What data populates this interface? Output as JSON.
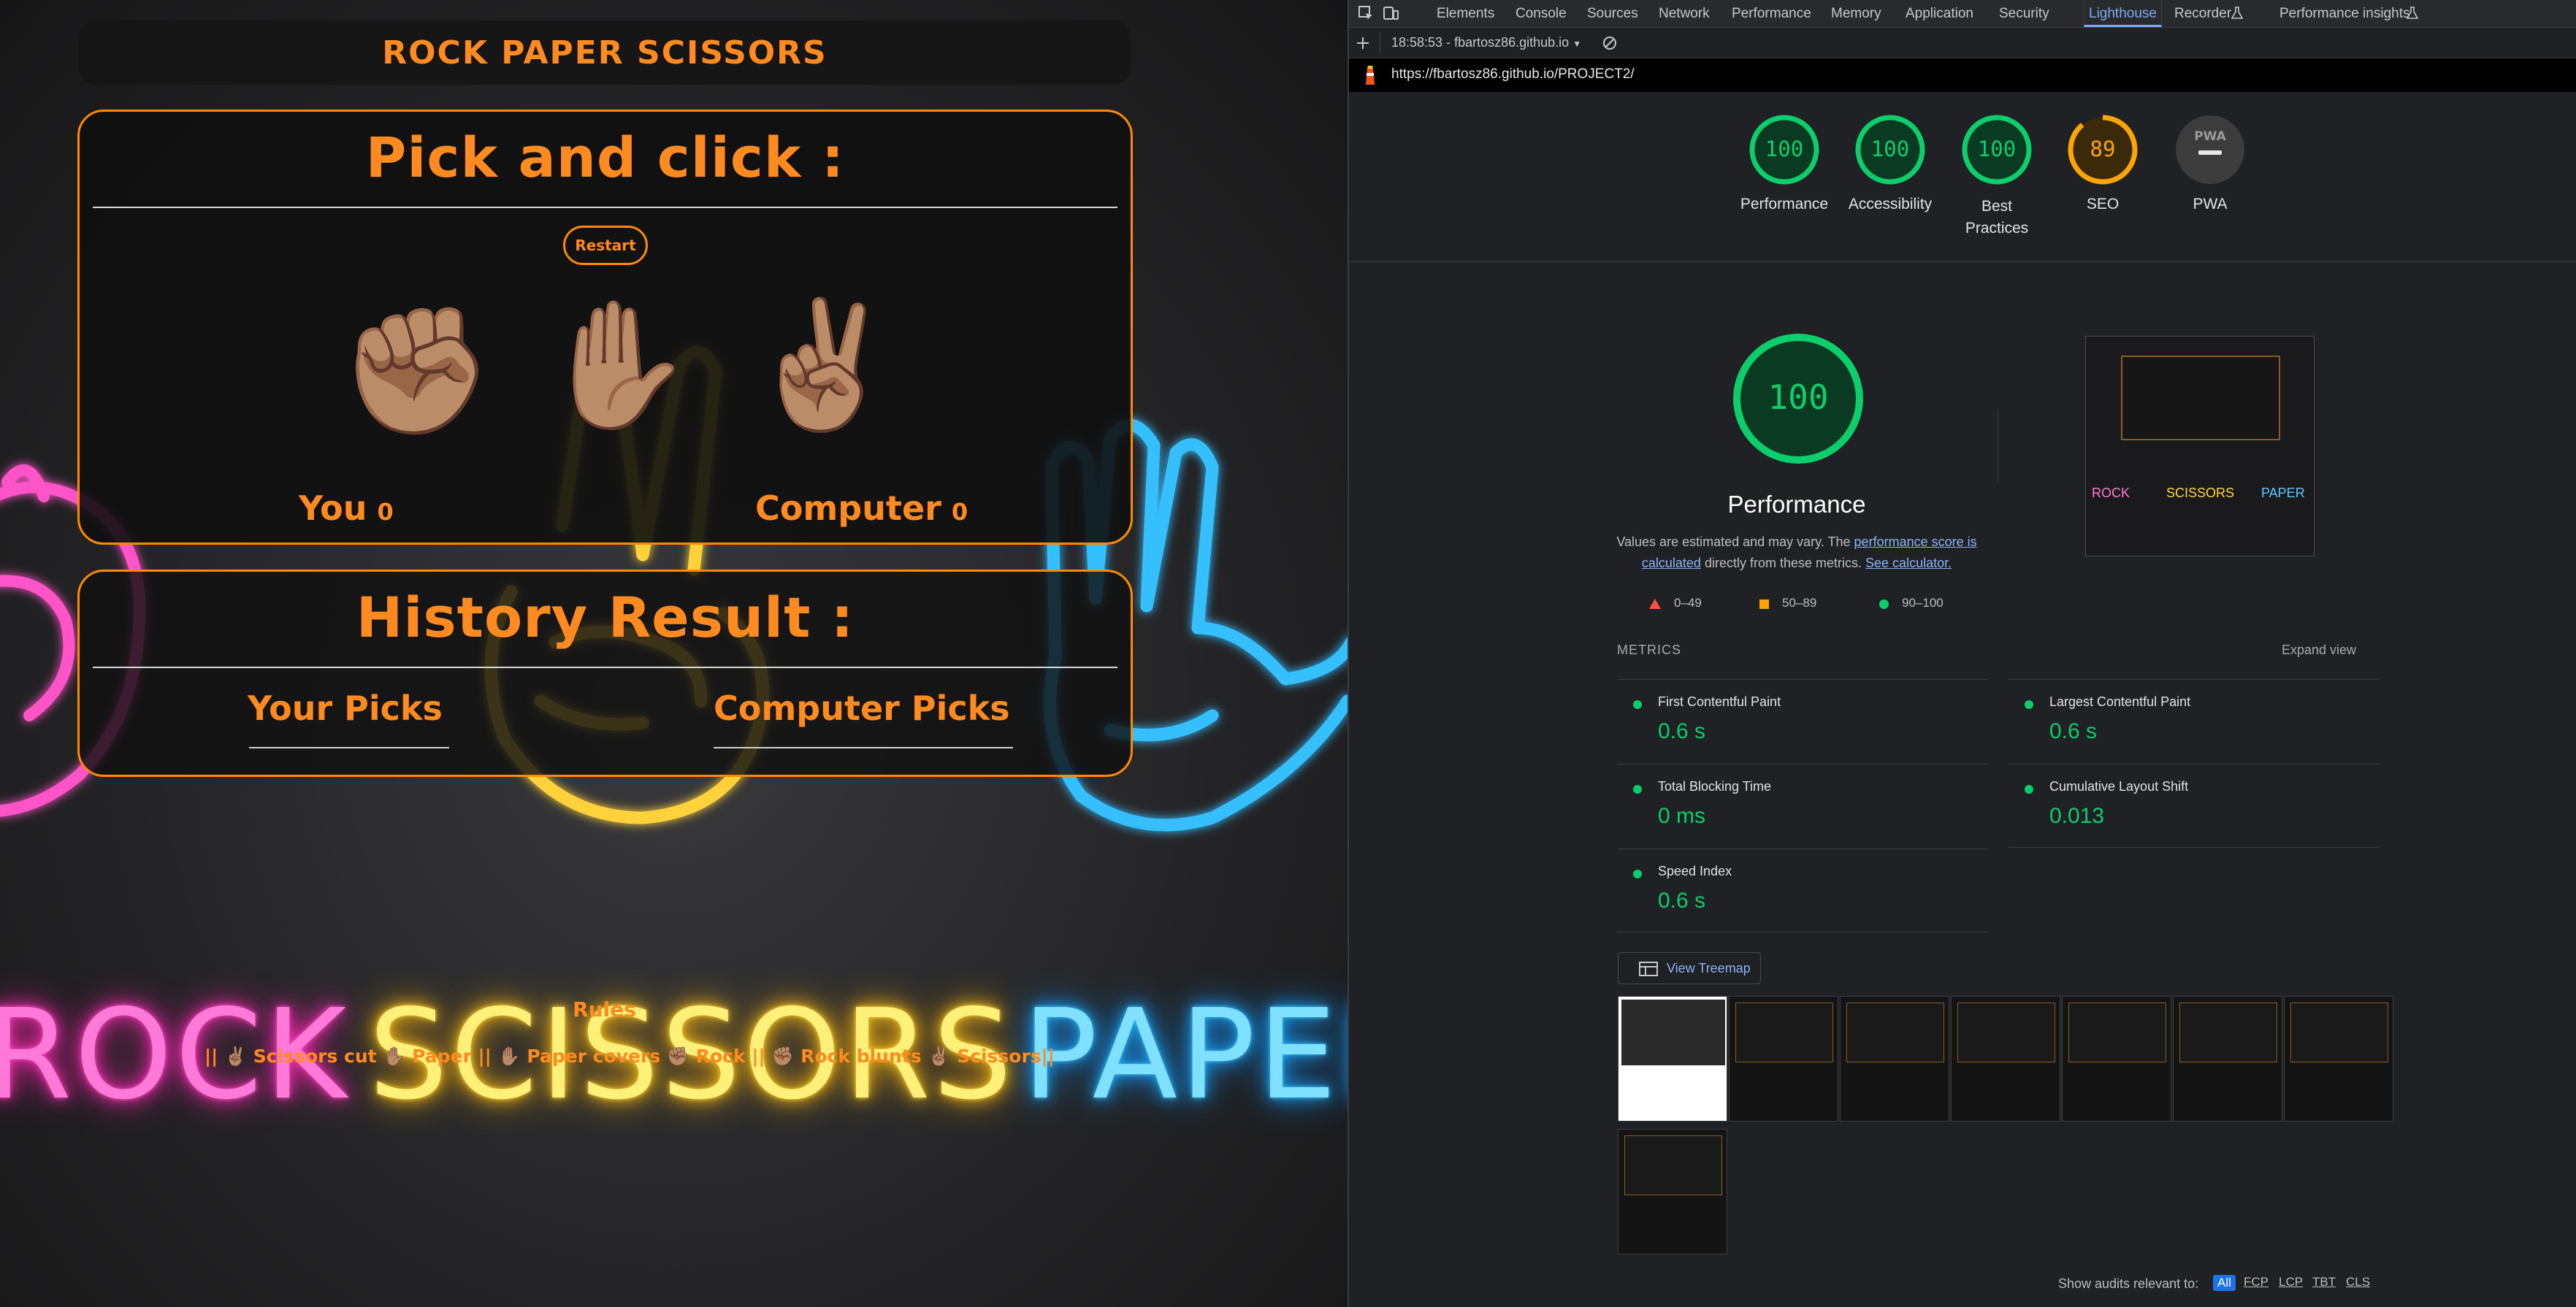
{
  "game": {
    "title": "ROCK PAPER SCISSORS",
    "pick_heading": "Pick and click :",
    "restart_label": "Restart",
    "hands": {
      "rock": "✊🏽",
      "paper": "✋🏽",
      "scissors": "✌🏽"
    },
    "you_label": "You",
    "you_score": "0",
    "computer_label": "Computer",
    "computer_score": "0",
    "history_heading": "History Result :",
    "your_picks_label": "Your Picks",
    "computer_picks_label": "Computer Picks",
    "rules_heading": "Rules",
    "rules_text": "|| ✌🏽 Scissors cut ✋🏽 Paper || ✋🏽 Paper covers ✊🏽 Rock || ✊🏽 Rock blunts ✌🏽 Scissors||",
    "neon": {
      "rock": "ROCK",
      "scissors": "SCISSORS",
      "paper": "PAPER"
    },
    "colors": {
      "accent": "#ff8a00",
      "neon_pink": "#ff4fc8",
      "neon_yellow": "#ffd83a",
      "neon_blue": "#3cc3ff"
    }
  },
  "devtools": {
    "tabs": [
      "Elements",
      "Console",
      "Sources",
      "Network",
      "Performance",
      "Memory",
      "Application",
      "Security",
      "Lighthouse",
      "Recorder",
      "Performance insights"
    ],
    "active_tab": "Lighthouse",
    "report_selector": "18:58:53 - fbartosz86.github.io",
    "url": "https://fbartosz86.github.io/PROJECT2/",
    "scores": [
      {
        "label": "Performance",
        "value": "100"
      },
      {
        "label": "Accessibility",
        "value": "100"
      },
      {
        "label": "Best Practices",
        "value": "100"
      },
      {
        "label": "SEO",
        "value": "89"
      },
      {
        "label": "PWA",
        "value": "PWA"
      }
    ],
    "main_score": "100",
    "main_title": "Performance",
    "desc_prefix": "Values are estimated and may vary. The",
    "desc_link1": "performance score is calculated",
    "desc_mid": "directly from these metrics.",
    "desc_link2": "See calculator.",
    "legend": [
      "0–49",
      "50–89",
      "90–100"
    ],
    "metrics_label": "METRICS",
    "expand_view": "Expand view",
    "metrics": [
      {
        "name": "First Contentful Paint",
        "value": "0.6 s"
      },
      {
        "name": "Largest Contentful Paint",
        "value": "0.6 s"
      },
      {
        "name": "Total Blocking Time",
        "value": "0 ms"
      },
      {
        "name": "Cumulative Layout Shift",
        "value": "0.013"
      },
      {
        "name": "Speed Index",
        "value": "0.6 s"
      }
    ],
    "treemap_label": "View Treemap",
    "audits_label": "Show audits relevant to:",
    "audit_chips": [
      "All",
      "FCP",
      "LCP",
      "TBT",
      "CLS"
    ],
    "colors": {
      "pass": "#0cce6b",
      "average": "#ffa400",
      "fail": "#ff4e42",
      "link": "#8ab4f8"
    }
  }
}
